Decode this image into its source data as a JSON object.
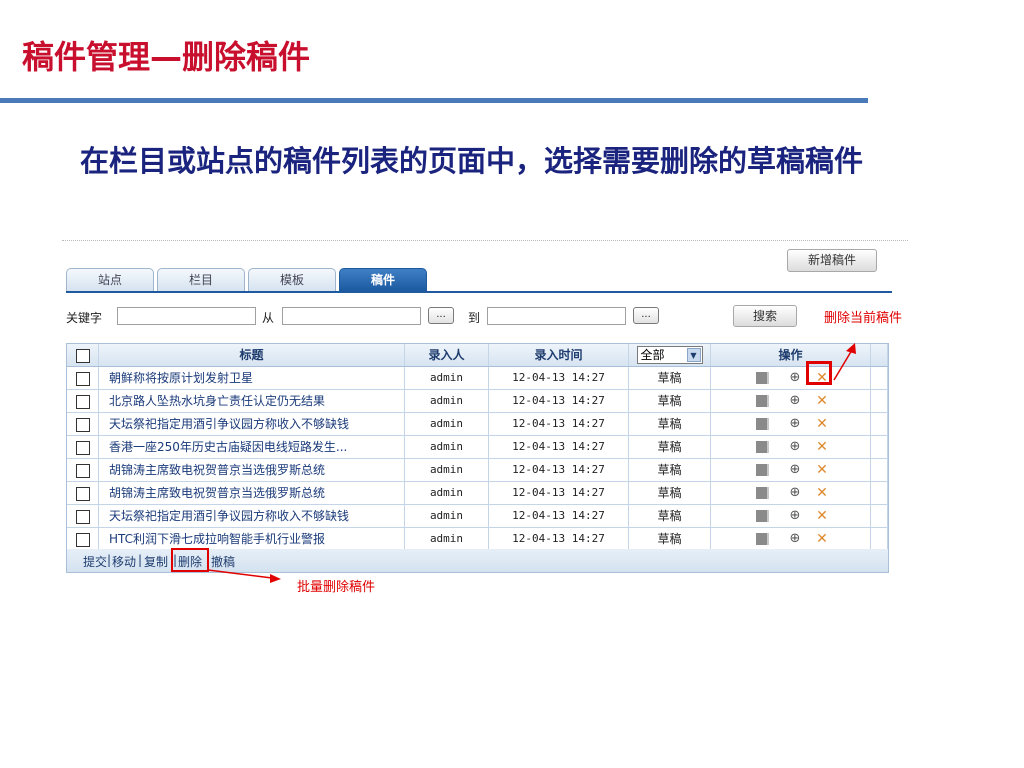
{
  "slide": {
    "title": "稿件管理—删除稿件",
    "subtitle": "在栏目或站点的稿件列表的页面中，选择需要删除的草稿稿件"
  },
  "toolbar": {
    "new_label": "新增稿件",
    "search_label": "搜索"
  },
  "tabs": [
    {
      "label": "站点"
    },
    {
      "label": "栏目"
    },
    {
      "label": "模板"
    },
    {
      "label": "稿件",
      "active": true
    }
  ],
  "search": {
    "keyword_label": "关键字",
    "from_label": "从",
    "to_label": "到",
    "picker_label": "..."
  },
  "annotations": {
    "delete_current": "删除当前稿件",
    "batch_delete": "批量删除稿件"
  },
  "table": {
    "headers": {
      "title": "标题",
      "author": "录入人",
      "time": "录入时间",
      "status_filter": "全部",
      "ops": "操作"
    },
    "rows": [
      {
        "title": "朝鲜称将按原计划发射卫星",
        "author": "admin",
        "time": "12-04-13 14:27",
        "status": "草稿"
      },
      {
        "title": "北京路人坠热水坑身亡责任认定仍无结果",
        "author": "admin",
        "time": "12-04-13 14:27",
        "status": "草稿"
      },
      {
        "title": "天坛祭祀指定用酒引争议园方称收入不够缺钱",
        "author": "admin",
        "time": "12-04-13 14:27",
        "status": "草稿"
      },
      {
        "title": "香港一座250年历史古庙疑因电线短路发生...",
        "author": "admin",
        "time": "12-04-13 14:27",
        "status": "草稿"
      },
      {
        "title": "胡锦涛主席致电祝贺普京当选俄罗斯总统",
        "author": "admin",
        "time": "12-04-13 14:27",
        "status": "草稿"
      },
      {
        "title": "胡锦涛主席致电祝贺普京当选俄罗斯总统",
        "author": "admin",
        "time": "12-04-13 14:27",
        "status": "草稿"
      },
      {
        "title": "天坛祭祀指定用酒引争议园方称收入不够缺钱",
        "author": "admin",
        "time": "12-04-13 14:27",
        "status": "草稿"
      },
      {
        "title": "HTC利润下滑七成拉响智能手机行业警报",
        "author": "admin",
        "time": "12-04-13 14:27",
        "status": "草稿"
      }
    ]
  },
  "footer": {
    "submit": "提交",
    "move": "移动",
    "copy": "复制",
    "delete": "删除",
    "withdraw": "撤稿",
    "sep": "|"
  },
  "colors": {
    "title_red": "#c8102e",
    "subtitle_navy": "#1a237e",
    "accent_blue": "#1c5aa0",
    "annotation_red": "#e00000"
  }
}
